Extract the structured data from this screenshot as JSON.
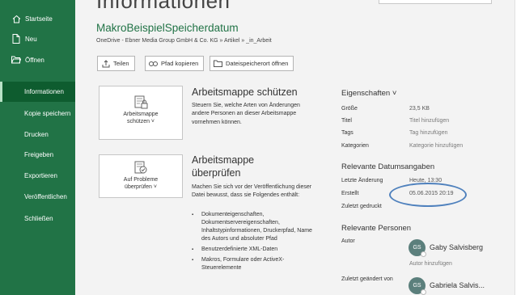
{
  "sidebar": {
    "items": [
      {
        "label": "Startseite",
        "icon": "home-icon"
      },
      {
        "label": "Neu",
        "icon": "new-file-icon"
      },
      {
        "label": "Öffnen",
        "icon": "open-folder-icon"
      },
      {
        "label": "Informationen",
        "icon": ""
      },
      {
        "label": "Kopie speichern",
        "icon": ""
      },
      {
        "label": "Drucken",
        "icon": ""
      },
      {
        "label": "Freigeben",
        "icon": ""
      },
      {
        "label": "Exportieren",
        "icon": ""
      },
      {
        "label": "Veröffentlichen",
        "icon": ""
      },
      {
        "label": "Schließen",
        "icon": ""
      }
    ],
    "active": "Informationen",
    "bg_color": "#217346"
  },
  "main": {
    "title": "Informationen",
    "doc_name": "MakroBeispielSpeicherdatum",
    "doc_path": "OneDrive - Ebner Media Group GmbH & Co. KG » Artikel » _in_Arbeit",
    "buttons": {
      "share": "Teilen",
      "copy_path": "Pfad kopieren",
      "open_location": "Dateispeicherort öffnen"
    }
  },
  "protect": {
    "button_line1": "Arbeitsmappe",
    "button_line2": "schützen ˅",
    "title": "Arbeitsmappe schützen",
    "text": "Steuern Sie, welche Arten von Änderungen andere Personen an dieser Arbeitsmappe vornehmen können."
  },
  "inspect": {
    "button_line1": "Auf Probleme",
    "button_line2": "überprüfen ˅",
    "title_line1": "Arbeitsmappe",
    "title_line2": "überprüfen",
    "text": "Machen Sie sich vor der Veröffentlichung dieser Datei bewusst, dass sie Folgendes enthält:",
    "bullets": [
      "Dokumenteigenschaften, Dokumentservereigenschaften, Inhaltstypinformationen, Druckerpfad, Name des Autors und absoluter Pfad",
      "Benutzerdefinierte XML-Daten",
      "Makros, Formulare oder ActiveX-Steuerelemente"
    ]
  },
  "properties": {
    "heading": "Eigenschaften ˅",
    "rows": [
      {
        "key": "Größe",
        "value": "23,5 KB"
      },
      {
        "key": "Titel",
        "value": "Titel hinzufügen"
      },
      {
        "key": "Tags",
        "value": "Tag hinzufügen"
      },
      {
        "key": "Kategorien",
        "value": "Kategorie hinzufügen"
      }
    ]
  },
  "dates": {
    "heading": "Relevante Datumsangaben",
    "rows": [
      {
        "key": "Letzte Änderung",
        "value": "Heute, 13:30"
      },
      {
        "key": "Erstellt",
        "value": "05.06.2015 20:19"
      },
      {
        "key": "Zuletzt gedruckt",
        "value": ""
      }
    ]
  },
  "people": {
    "heading": "Relevante Personen",
    "author_label": "Autor",
    "author_initials": "GS",
    "author_name": "Gaby Salvisberg",
    "add_author": "Autor hinzufügen",
    "modified_label": "Zuletzt geändert von",
    "modified_initials": "GS",
    "modified_name": "Gabriela Salvis..."
  }
}
